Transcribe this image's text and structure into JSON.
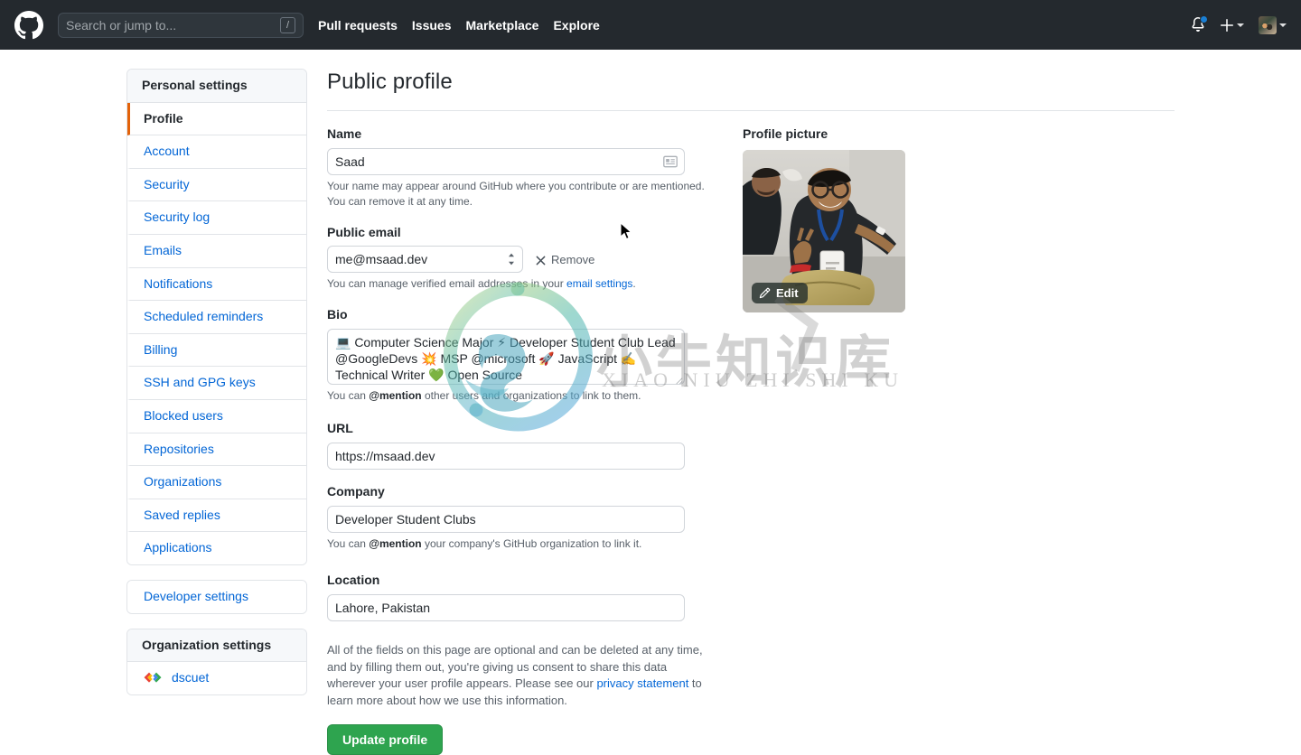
{
  "header": {
    "logo_icon": "github-mark-icon",
    "search": {
      "placeholder": "Search or jump to...",
      "value": "",
      "shortcut_key": "/"
    },
    "nav": [
      {
        "label": "Pull requests"
      },
      {
        "label": "Issues"
      },
      {
        "label": "Marketplace"
      },
      {
        "label": "Explore"
      }
    ],
    "notifications_icon": "bell-icon",
    "has_unread_notifications": true,
    "create_new_icon": "plus-icon",
    "avatar_icon": "user-avatar",
    "dropdown_icon": "caret-down-icon"
  },
  "sidebar": {
    "personal": {
      "heading": "Personal settings",
      "items": [
        {
          "label": "Profile",
          "selected": true
        },
        {
          "label": "Account",
          "selected": false
        },
        {
          "label": "Security",
          "selected": false
        },
        {
          "label": "Security log",
          "selected": false
        },
        {
          "label": "Emails",
          "selected": false
        },
        {
          "label": "Notifications",
          "selected": false
        },
        {
          "label": "Scheduled reminders",
          "selected": false
        },
        {
          "label": "Billing",
          "selected": false
        },
        {
          "label": "SSH and GPG keys",
          "selected": false
        },
        {
          "label": "Blocked users",
          "selected": false
        },
        {
          "label": "Repositories",
          "selected": false
        },
        {
          "label": "Organizations",
          "selected": false
        },
        {
          "label": "Saved replies",
          "selected": false
        },
        {
          "label": "Applications",
          "selected": false
        }
      ]
    },
    "developer": {
      "label": "Developer settings"
    },
    "organization": {
      "heading": "Organization settings",
      "items": [
        {
          "label": "dscuet",
          "icon": "code-brackets-icon"
        }
      ]
    }
  },
  "main": {
    "title": "Public profile",
    "name": {
      "label": "Name",
      "value": "Saad",
      "icon": "contact-card-icon",
      "help": "Your name may appear around GitHub where you contribute or are mentioned. You can remove it at any time."
    },
    "public_email": {
      "label": "Public email",
      "value": "me@msaad.dev",
      "options": [
        "me@msaad.dev"
      ],
      "remove_label": "Remove",
      "remove_icon": "x-icon",
      "help_prefix": "You can manage verified email addresses in your ",
      "help_link": "email settings",
      "help_suffix": "."
    },
    "bio": {
      "label": "Bio",
      "value": "💻 Computer Science Major ⚡ Developer Student Club Lead @GoogleDevs 💥 MSP @microsoft 🚀 JavaScript ✍️ Technical Writer 💚 Open Source",
      "help_prefix": "You can ",
      "help_bold": "@mention",
      "help_suffix": " other users and organizations to link to them."
    },
    "url": {
      "label": "URL",
      "value": "https://msaad.dev"
    },
    "company": {
      "label": "Company",
      "value": "Developer Student Clubs",
      "help_prefix": "You can ",
      "help_bold": "@mention",
      "help_suffix": " your company's GitHub organization to link it."
    },
    "location": {
      "label": "Location",
      "value": "Lahore, Pakistan"
    },
    "consent": {
      "part1": "All of the fields on this page are optional and can be deleted at any time, and by filling them out, you're giving us consent to share this data wherever your user profile appears. Please see our ",
      "link": "privacy statement",
      "part2": " to learn more about how we use this information."
    },
    "submit_label": "Update profile",
    "profile_picture": {
      "label": "Profile picture",
      "edit_label": "Edit",
      "edit_icon": "pencil-icon"
    }
  },
  "watermark": {
    "chinese": "小牛知识库",
    "pinyin": "XIAO NIU ZHI SHI KU"
  },
  "colors": {
    "header_bg": "#24292e",
    "link": "#0366d6",
    "accent_active": "#e36209",
    "button_green": "#2ea44f",
    "border": "#e1e4e8"
  }
}
